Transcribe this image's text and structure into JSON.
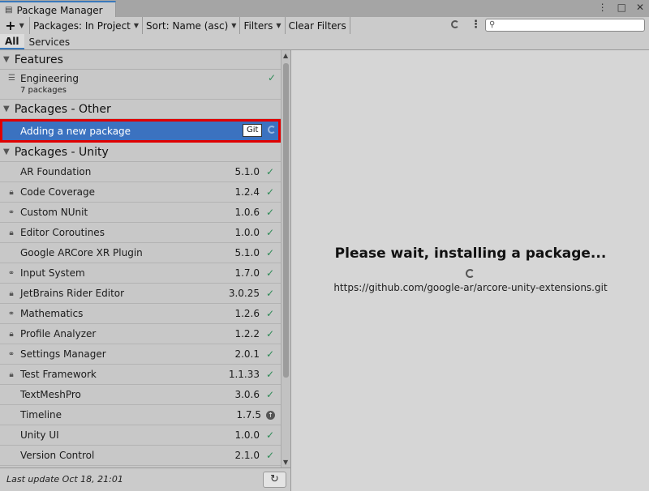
{
  "window": {
    "title": "Package Manager",
    "controls": [
      "⋮",
      "□",
      "✕"
    ]
  },
  "toolbar": {
    "add_icon": "plus-icon",
    "packages_dropdown": "Packages: In Project",
    "sort_dropdown": "Sort: Name (asc)",
    "filters_dropdown": "Filters",
    "clear_filters": "Clear Filters",
    "search_placeholder": ""
  },
  "tabs": [
    {
      "label": "All",
      "active": true
    },
    {
      "label": "Services",
      "active": false
    }
  ],
  "groups": {
    "features": "Features",
    "other": "Packages - Other",
    "unity": "Packages - Unity"
  },
  "features": [
    {
      "name": "Engineering",
      "sub": "7 packages",
      "status": "✓"
    }
  ],
  "other_packages": [
    {
      "name": "Adding a new package",
      "badge": "Git"
    }
  ],
  "unity_packages": [
    {
      "name": "AR Foundation",
      "version": "5.1.0",
      "icon": "",
      "status": "✓"
    },
    {
      "name": "Code Coverage",
      "version": "1.2.4",
      "icon": "lock",
      "status": "✓"
    },
    {
      "name": "Custom NUnit",
      "version": "1.0.6",
      "icon": "link",
      "status": "✓"
    },
    {
      "name": "Editor Coroutines",
      "version": "1.0.0",
      "icon": "lock",
      "status": "✓"
    },
    {
      "name": "Google ARCore XR Plugin",
      "version": "5.1.0",
      "icon": "",
      "status": "✓"
    },
    {
      "name": "Input System",
      "version": "1.7.0",
      "icon": "link",
      "status": "✓"
    },
    {
      "name": "JetBrains Rider Editor",
      "version": "3.0.25",
      "icon": "lock",
      "status": "✓"
    },
    {
      "name": "Mathematics",
      "version": "1.2.6",
      "icon": "link",
      "status": "✓"
    },
    {
      "name": "Profile Analyzer",
      "version": "1.2.2",
      "icon": "lock",
      "status": "✓"
    },
    {
      "name": "Settings Manager",
      "version": "2.0.1",
      "icon": "link",
      "status": "✓"
    },
    {
      "name": "Test Framework",
      "version": "1.1.33",
      "icon": "lock",
      "status": "✓"
    },
    {
      "name": "TextMeshPro",
      "version": "3.0.6",
      "icon": "",
      "status": "✓"
    },
    {
      "name": "Timeline",
      "version": "1.7.5",
      "icon": "",
      "status": "update"
    },
    {
      "name": "Unity UI",
      "version": "1.0.0",
      "icon": "",
      "status": "✓"
    },
    {
      "name": "Version Control",
      "version": "2.1.0",
      "icon": "",
      "status": "✓"
    }
  ],
  "footer": {
    "last_update": "Last update Oct 18, 21:01"
  },
  "detail": {
    "title": "Please wait, installing a package...",
    "url": "https://github.com/google-ar/arcore-unity-extensions.git"
  },
  "colors": {
    "selection": "#3b72c0",
    "highlight_border": "#e00000",
    "check": "#2d8a56"
  }
}
